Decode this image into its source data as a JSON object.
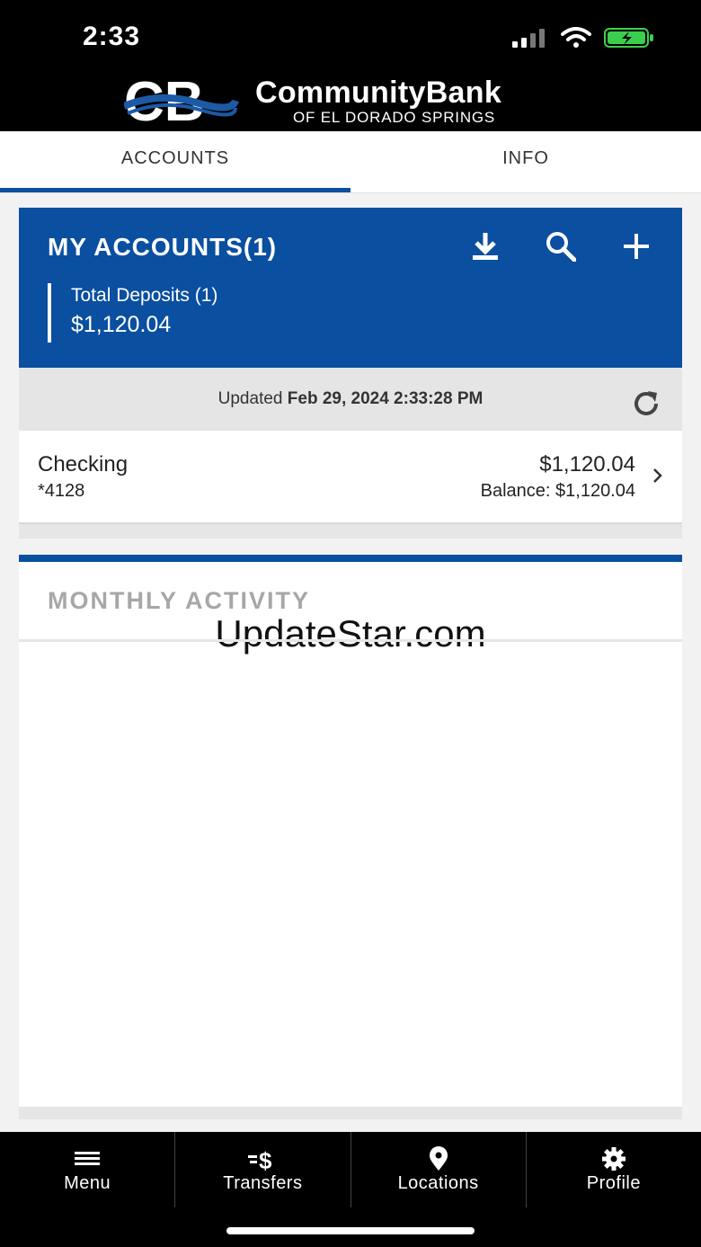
{
  "status_bar": {
    "time": "2:33"
  },
  "header": {
    "bank_name": "CommunityBank",
    "bank_subtitle": "OF EL DORADO SPRINGS"
  },
  "tabs": [
    {
      "label": "ACCOUNTS"
    },
    {
      "label": "INFO"
    }
  ],
  "accounts_panel": {
    "title": "MY ACCOUNTS(1)",
    "deposit_label": "Total Deposits (1)",
    "deposit_amount": "$1,120.04"
  },
  "updated": {
    "prefix": "Updated",
    "timestamp": "Feb 29, 2024 2:33:28 PM"
  },
  "account": {
    "name": "Checking",
    "number": "*4128",
    "amount": "$1,120.04",
    "balance": "Balance: $1,120.04"
  },
  "activity": {
    "title": "MONTHLY ACTIVITY",
    "watermark": "UpdateStar.com"
  },
  "bottom_nav": [
    {
      "label": "Menu",
      "icon": "menu-icon"
    },
    {
      "label": "Transfers",
      "icon": "transfers-icon"
    },
    {
      "label": "Locations",
      "icon": "location-pin-icon"
    },
    {
      "label": "Profile",
      "icon": "gear-icon"
    }
  ],
  "colors": {
    "brand_blue": "#0a4fa0",
    "battery_green": "#3ccf4e"
  }
}
